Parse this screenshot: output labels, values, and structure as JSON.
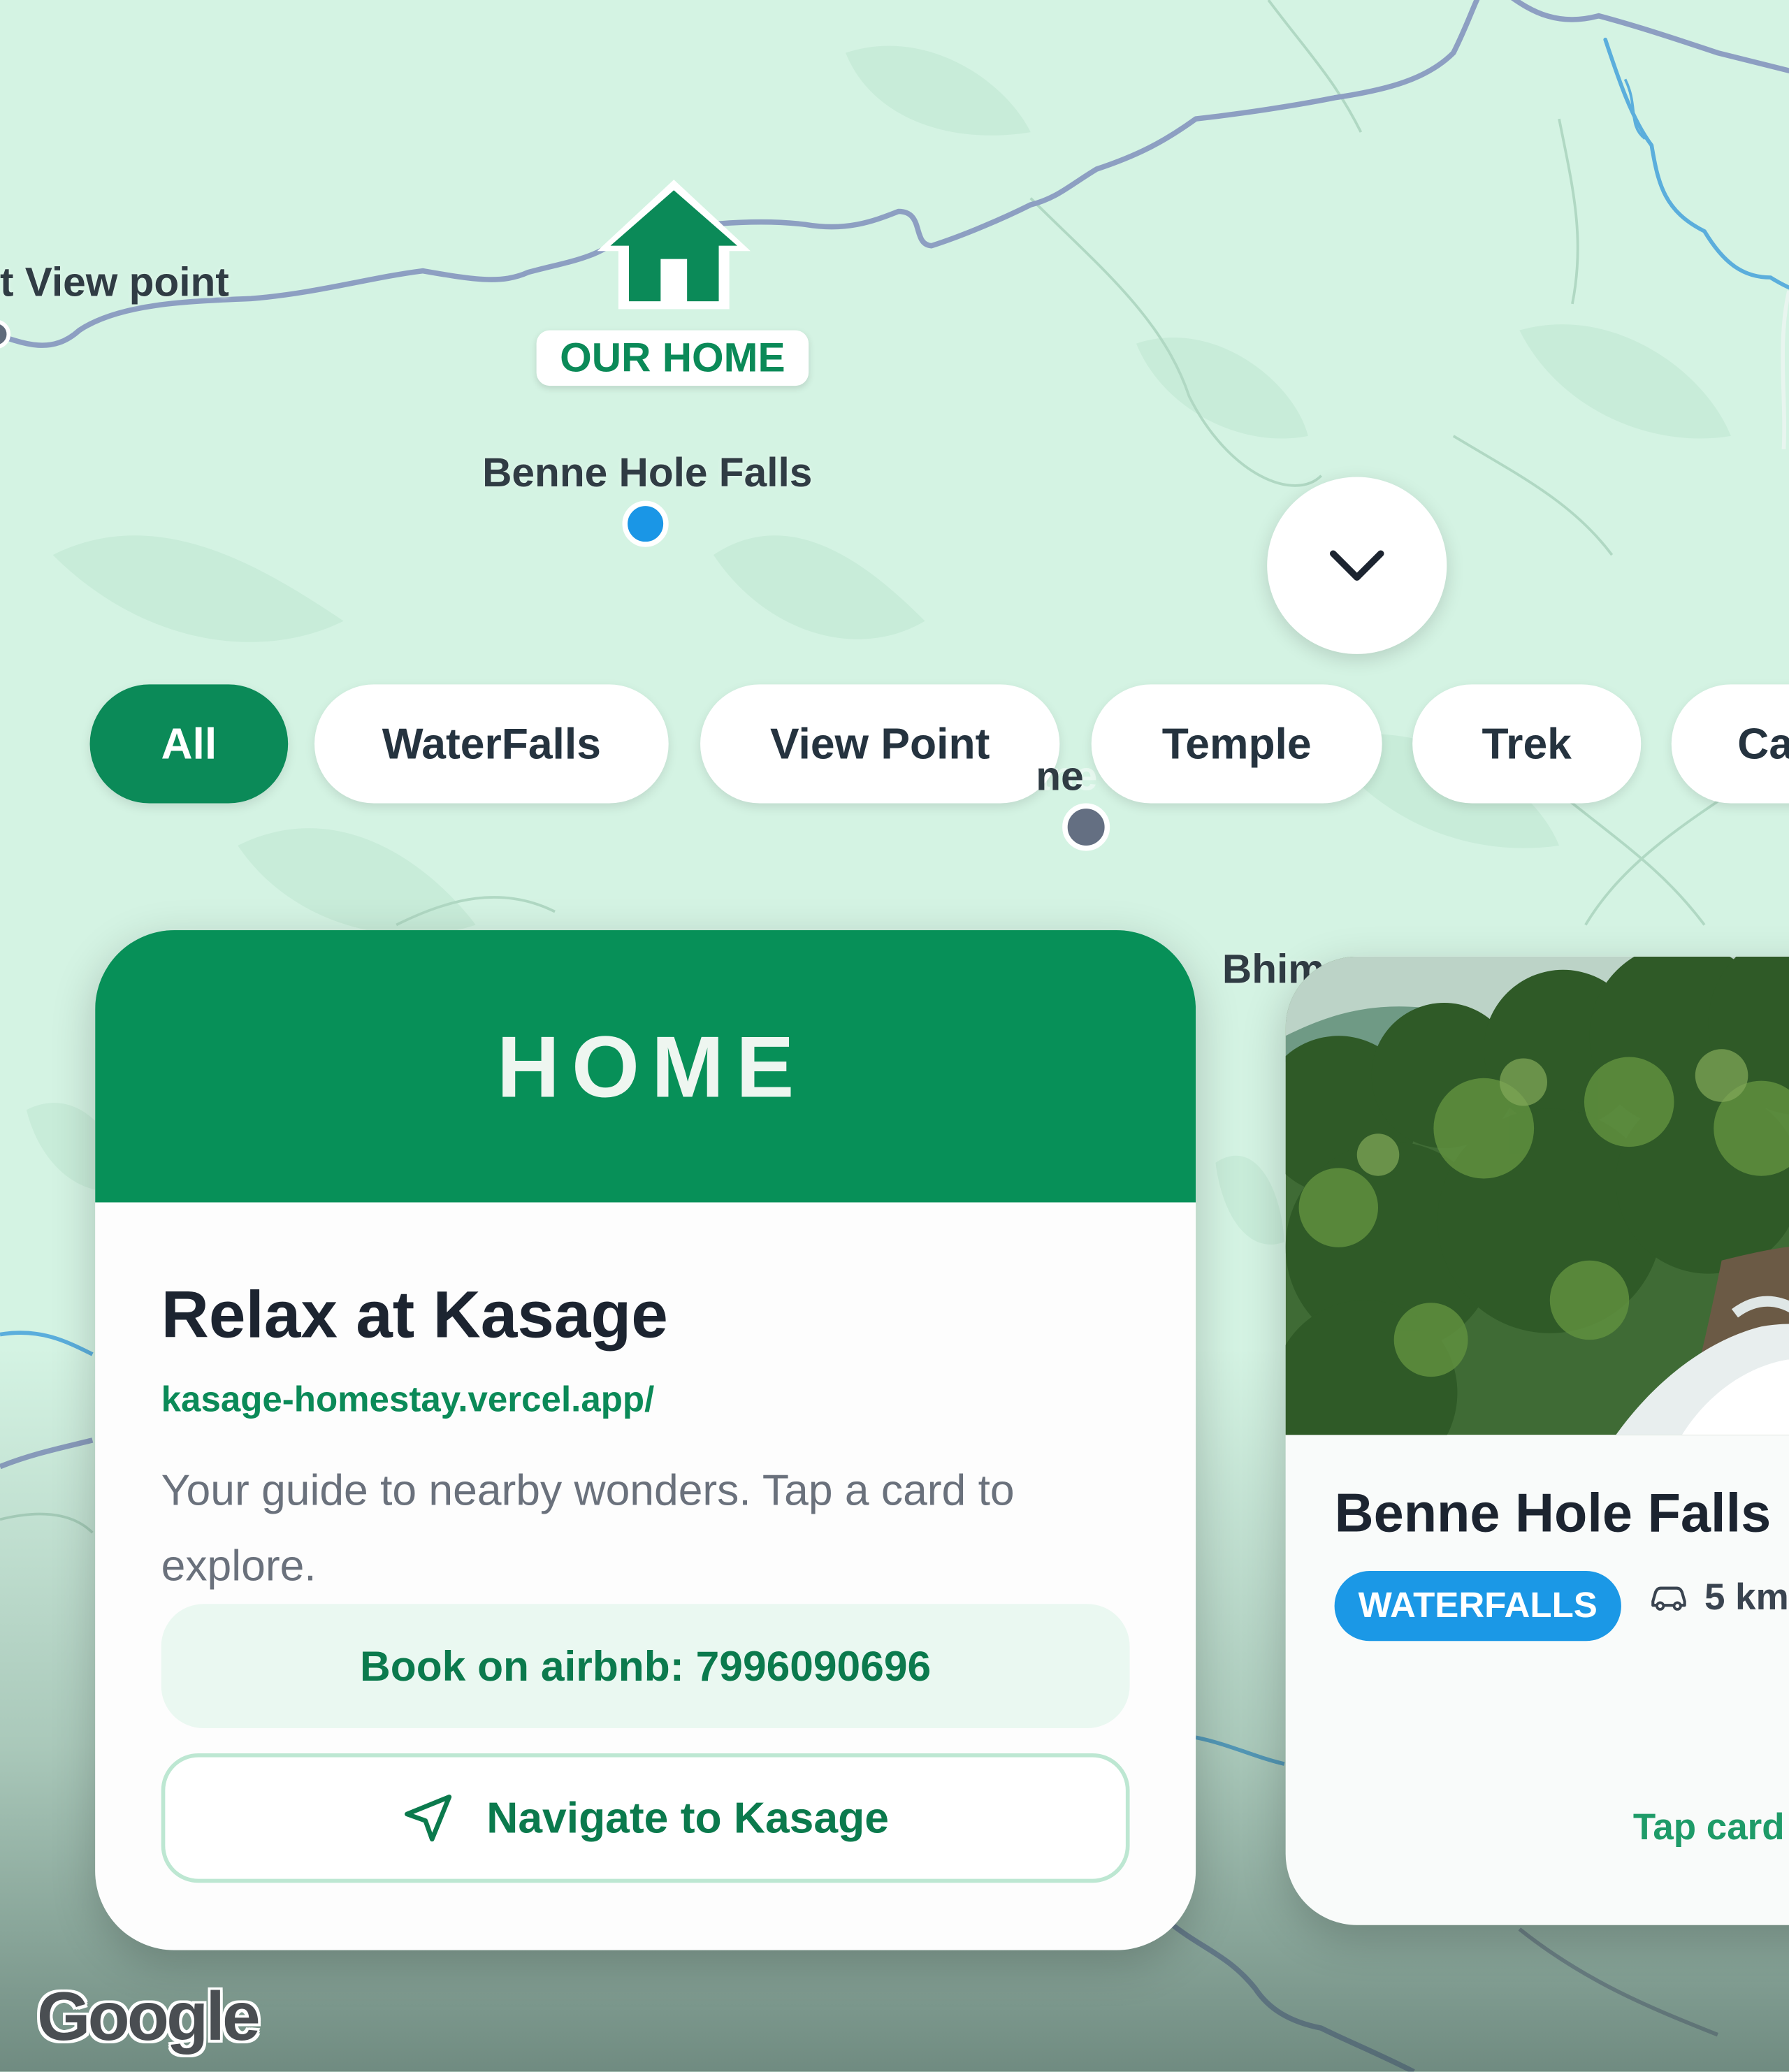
{
  "map": {
    "labels": {
      "viewpoint_left": "t View point",
      "benne_hole": "Benne Hole Falls",
      "nishane_gudda": "Nishane Gudda",
      "nishane_gudda_visible": "ne",
      "bhima": "Bhim"
    },
    "home_tag": "OUR HOME",
    "attribution": "Google",
    "colors": {
      "land": "#d4f3e3",
      "road": "#8d9fc2",
      "river": "#5baedc",
      "home_marker": "#0b8a58"
    }
  },
  "filters": {
    "chips": [
      "All",
      "WaterFalls",
      "View Point",
      "Temple",
      "Trek",
      "Ca"
    ],
    "active_index": 0
  },
  "expand_button": {
    "icon": "chevron-down-icon"
  },
  "home_card": {
    "header": "HOME",
    "title": "Relax at Kasage",
    "link": "kasage-homestay.vercel.app/",
    "description": "Your guide to nearby wonders. Tap a card to explore.",
    "airbnb": "Book on airbnb: 7996090696",
    "navigate_label": "Navigate to Kasage",
    "navigate_icon": "navigation-arrow-icon",
    "accent": "#079058"
  },
  "place_card": {
    "title": "Benne Hole Falls",
    "category": "WATERFALLS",
    "distance": "5 km",
    "distance_icon": "car-icon",
    "hint": "Tap card",
    "badge_color": "#1b98e6"
  }
}
